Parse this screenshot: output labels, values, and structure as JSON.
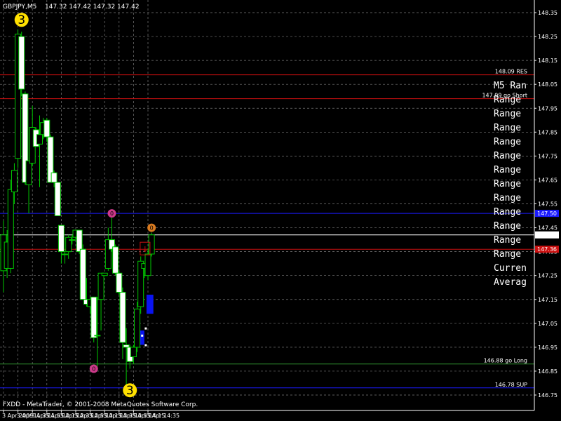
{
  "header": {
    "symbol": "GBPJPY,M5",
    "ohlc": "147.32 147.42 147.32 147.42"
  },
  "footer": {
    "copyright": "FXDD - MetaTrader, © 2001-2008 MetaQuotes Software Corp."
  },
  "colors": {
    "background": "#000000",
    "grid": "#7a7a7a",
    "bull": "#00c800",
    "bear_fill": "#ffffff",
    "axis": "#ffffff",
    "res": "#cc1010",
    "sup": "#1a1aff",
    "long": "#2f8f2f",
    "box": "#0a14f0"
  },
  "chart_data": {
    "type": "candlestick",
    "ylim": [
      146.7,
      148.35
    ],
    "yticks": [
      148.35,
      148.25,
      148.15,
      148.05,
      147.95,
      147.85,
      147.75,
      147.65,
      147.55,
      147.45,
      147.42,
      147.35,
      147.25,
      147.15,
      147.05,
      146.95,
      146.85,
      146.75
    ],
    "xticks": [
      "3 Apr 2009",
      "3 Apr 11:35",
      "3 Apr 11:55",
      "3 Apr 12:15",
      "3 Apr 12:35",
      "3 Apr 12:55",
      "3 Apr 13:15",
      "3 Apr 13:35",
      "3 Apr 13:55",
      "3 Apr 14:15",
      "3 Apr 14:35"
    ],
    "xtick_bars": [
      0,
      4,
      8,
      12,
      16,
      20,
      24,
      28,
      32,
      36,
      40
    ],
    "bar_step": 5.15,
    "first_bar_x": 5,
    "candles": [
      {
        "o": 147.27,
        "h": 147.48,
        "l": 147.18,
        "c": 147.42
      },
      {
        "o": 147.28,
        "h": 147.44,
        "l": 147.24,
        "c": 147.39
      },
      {
        "o": 147.28,
        "h": 147.65,
        "l": 147.26,
        "c": 147.61
      },
      {
        "o": 147.6,
        "h": 147.72,
        "l": 147.55,
        "c": 147.69
      },
      {
        "o": 147.74,
        "h": 148.28,
        "l": 147.7,
        "c": 148.26
      },
      {
        "o": 148.25,
        "h": 148.27,
        "l": 148.0,
        "c": 148.03
      },
      {
        "o": 148.01,
        "h": 148.02,
        "l": 147.63,
        "c": 147.64
      },
      {
        "o": 147.63,
        "h": 147.73,
        "l": 147.51,
        "c": 147.73
      },
      {
        "o": 147.72,
        "h": 147.96,
        "l": 147.71,
        "c": 147.87
      },
      {
        "o": 147.86,
        "h": 147.87,
        "l": 147.79,
        "c": 147.79
      },
      {
        "o": 147.8,
        "h": 147.92,
        "l": 147.62,
        "c": 147.84
      },
      {
        "o": 147.84,
        "h": 147.91,
        "l": 147.82,
        "c": 147.89
      },
      {
        "o": 147.9,
        "h": 147.91,
        "l": 147.81,
        "c": 147.83
      },
      {
        "o": 147.83,
        "h": 147.84,
        "l": 147.64,
        "c": 147.64
      },
      {
        "o": 147.68,
        "h": 147.69,
        "l": 147.62,
        "c": 147.64
      },
      {
        "o": 147.64,
        "h": 147.64,
        "l": 147.5,
        "c": 147.5
      },
      {
        "o": 147.46,
        "h": 147.46,
        "l": 147.3,
        "c": 147.35
      },
      {
        "o": 147.34,
        "h": 147.35,
        "l": 147.3,
        "c": 147.34
      },
      {
        "o": 147.35,
        "h": 147.42,
        "l": 147.32,
        "c": 147.41
      },
      {
        "o": 147.4,
        "h": 147.42,
        "l": 147.38,
        "c": 147.4
      },
      {
        "o": 147.41,
        "h": 147.44,
        "l": 147.4,
        "c": 147.44
      },
      {
        "o": 147.44,
        "h": 147.44,
        "l": 147.34,
        "c": 147.35
      },
      {
        "o": 147.36,
        "h": 147.38,
        "l": 147.15,
        "c": 147.15
      },
      {
        "o": 147.15,
        "h": 147.24,
        "l": 147.12,
        "c": 147.13
      },
      {
        "o": 147.12,
        "h": 147.16,
        "l": 147.09,
        "c": 147.15
      },
      {
        "o": 147.16,
        "h": 147.16,
        "l": 146.97,
        "c": 146.99
      },
      {
        "o": 147.0,
        "h": 147.16,
        "l": 146.87,
        "c": 147.0
      },
      {
        "o": 147.15,
        "h": 147.26,
        "l": 147.02,
        "c": 147.26
      },
      {
        "o": 147.25,
        "h": 147.26,
        "l": 147.25,
        "c": 147.26
      },
      {
        "o": 147.28,
        "h": 147.45,
        "l": 147.27,
        "c": 147.4
      },
      {
        "o": 147.4,
        "h": 147.5,
        "l": 147.35,
        "c": 147.36
      },
      {
        "o": 147.37,
        "h": 147.38,
        "l": 147.25,
        "c": 147.26
      },
      {
        "o": 147.26,
        "h": 147.27,
        "l": 147.17,
        "c": 147.18
      },
      {
        "o": 147.18,
        "h": 147.2,
        "l": 146.9,
        "c": 146.97
      },
      {
        "o": 146.96,
        "h": 147.03,
        "l": 146.78,
        "c": 146.95
      },
      {
        "o": 146.95,
        "h": 146.96,
        "l": 146.86,
        "c": 146.89
      },
      {
        "o": 146.91,
        "h": 146.96,
        "l": 146.88,
        "c": 146.95
      },
      {
        "o": 146.95,
        "h": 147.14,
        "l": 146.93,
        "c": 147.11
      },
      {
        "o": 147.12,
        "h": 147.33,
        "l": 147.09,
        "c": 147.31
      },
      {
        "o": 147.28,
        "h": 147.3,
        "l": 147.24,
        "c": 147.3
      },
      {
        "o": 147.25,
        "h": 147.36,
        "l": 147.23,
        "c": 147.34
      },
      {
        "o": 147.34,
        "h": 147.43,
        "l": 147.33,
        "c": 147.42
      }
    ],
    "levels": [
      {
        "name": "res",
        "price": 148.09,
        "color": "#cc1010",
        "label": "148.09 RES",
        "tag": ""
      },
      {
        "name": "go-short",
        "price": 147.99,
        "color": "#cc1010",
        "label": "147.99 go Short",
        "tag": ""
      },
      {
        "name": "blue-top",
        "price": 147.51,
        "color": "#1a1aff",
        "label": "",
        "tag": "147.50"
      },
      {
        "name": "price",
        "price": 147.42,
        "color": "#ffffff",
        "label": "",
        "tag": ""
      },
      {
        "name": "red-mid",
        "price": 147.36,
        "color": "#cc1010",
        "label": "",
        "tag": "147.36"
      },
      {
        "name": "go-long",
        "price": 146.88,
        "color": "#2f8f2f",
        "label": "146.88 go Long",
        "tag": ""
      },
      {
        "name": "sup",
        "price": 146.78,
        "color": "#1a1aff",
        "label": "146.78 SUP",
        "tag": ""
      }
    ],
    "current_price_tag": "147.42",
    "boxes": [
      {
        "bar_from": 39.6,
        "bar_to": 41.5,
        "price_top": 147.17,
        "price_bottom": 147.09
      },
      {
        "bar_from": 37.6,
        "bar_to": 39.0,
        "price_top": 147.02,
        "price_bottom": 146.96
      }
    ],
    "markers": [
      {
        "type": "circle-3",
        "bar": 5,
        "price": 148.32,
        "label": "3",
        "color": "#ffe000"
      },
      {
        "type": "circle-3",
        "bar": 35,
        "price": 146.77,
        "label": "3",
        "color": "#ffe000"
      },
      {
        "type": "dot",
        "bar": 30,
        "price": 147.51,
        "label": "0",
        "color": "#cc3a8a"
      },
      {
        "type": "dot",
        "bar": 25,
        "price": 146.86,
        "label": "0",
        "color": "#cc3a8a"
      },
      {
        "type": "dot",
        "bar": 41,
        "price": 147.45,
        "label": "0",
        "color": "#d87a20"
      }
    ],
    "arrow": {
      "bar": 39.2,
      "price": 147.36,
      "glyph": "↓"
    },
    "side_text": [
      "M5 Ran",
      "Range",
      "Range",
      "Range",
      "Range",
      "Range",
      "Range",
      "Range",
      "Range",
      "Range",
      "Range",
      "Range",
      "Range",
      "Curren",
      "Averag"
    ]
  }
}
